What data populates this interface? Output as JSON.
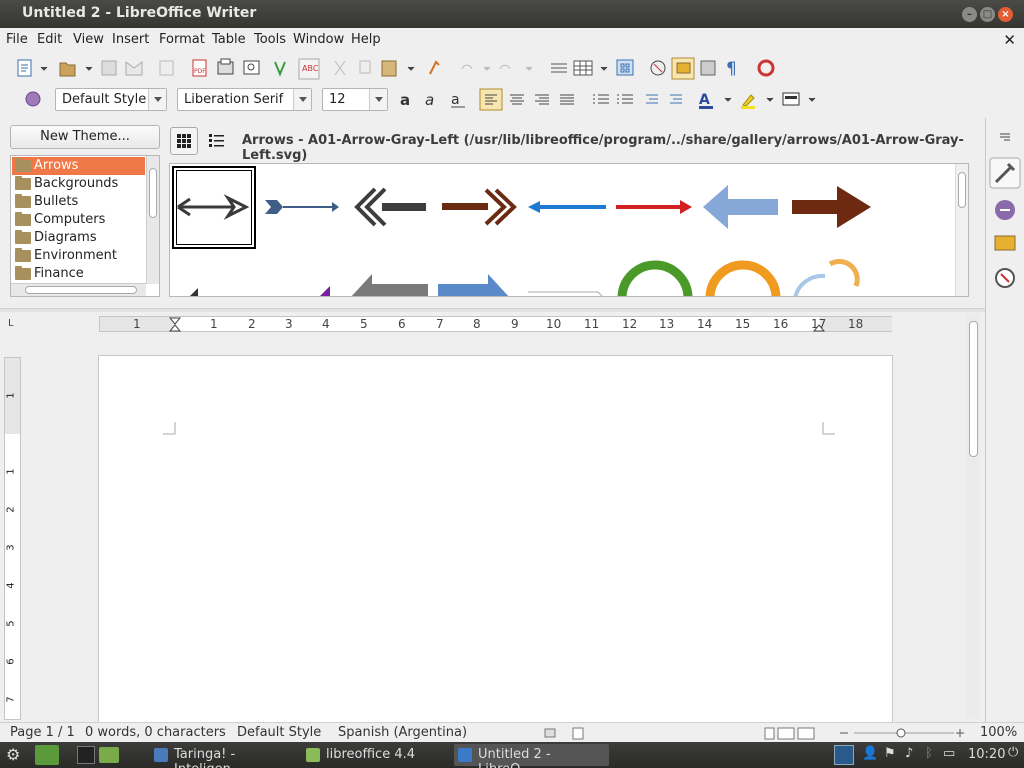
{
  "window": {
    "title": "Untitled 2 - LibreOffice Writer"
  },
  "menu": [
    "File",
    "Edit",
    "View",
    "Insert",
    "Format",
    "Table",
    "Tools",
    "Window",
    "Help"
  ],
  "formatting": {
    "paragraph_style": "Default Style",
    "font_name": "Liberation Serif",
    "font_size": "12"
  },
  "gallery": {
    "new_theme_label": "New Theme...",
    "path": "Arrows - A01-Arrow-Gray-Left (/usr/lib/libreoffice/program/../share/gallery/arrows/A01-Arrow-Gray-Left.svg)",
    "themes": [
      "Arrows",
      "Backgrounds",
      "Bullets",
      "Computers",
      "Diagrams",
      "Environment",
      "Finance"
    ],
    "selected_theme": "Arrows"
  },
  "ruler": {
    "ticks": [
      "1",
      "1",
      "2",
      "3",
      "4",
      "5",
      "6",
      "7",
      "8",
      "9",
      "10",
      "11",
      "12",
      "13",
      "14",
      "15",
      "16",
      "17",
      "18"
    ]
  },
  "vruler": {
    "ticks": [
      "1",
      "1",
      "2",
      "3",
      "4",
      "5",
      "6",
      "7"
    ]
  },
  "status": {
    "page": "Page 1 / 1",
    "words": "0 words, 0 characters",
    "style": "Default Style",
    "language": "Spanish (Argentina)",
    "zoom": "100%"
  },
  "taskbar": {
    "items": [
      "Taringa! - Inteligen...",
      "libreoffice 4.4",
      "Untitled 2 - LibreO..."
    ],
    "clock": "10:20"
  },
  "colors": {
    "accent": "#f07746",
    "titlebar": "#3d3d3a"
  }
}
